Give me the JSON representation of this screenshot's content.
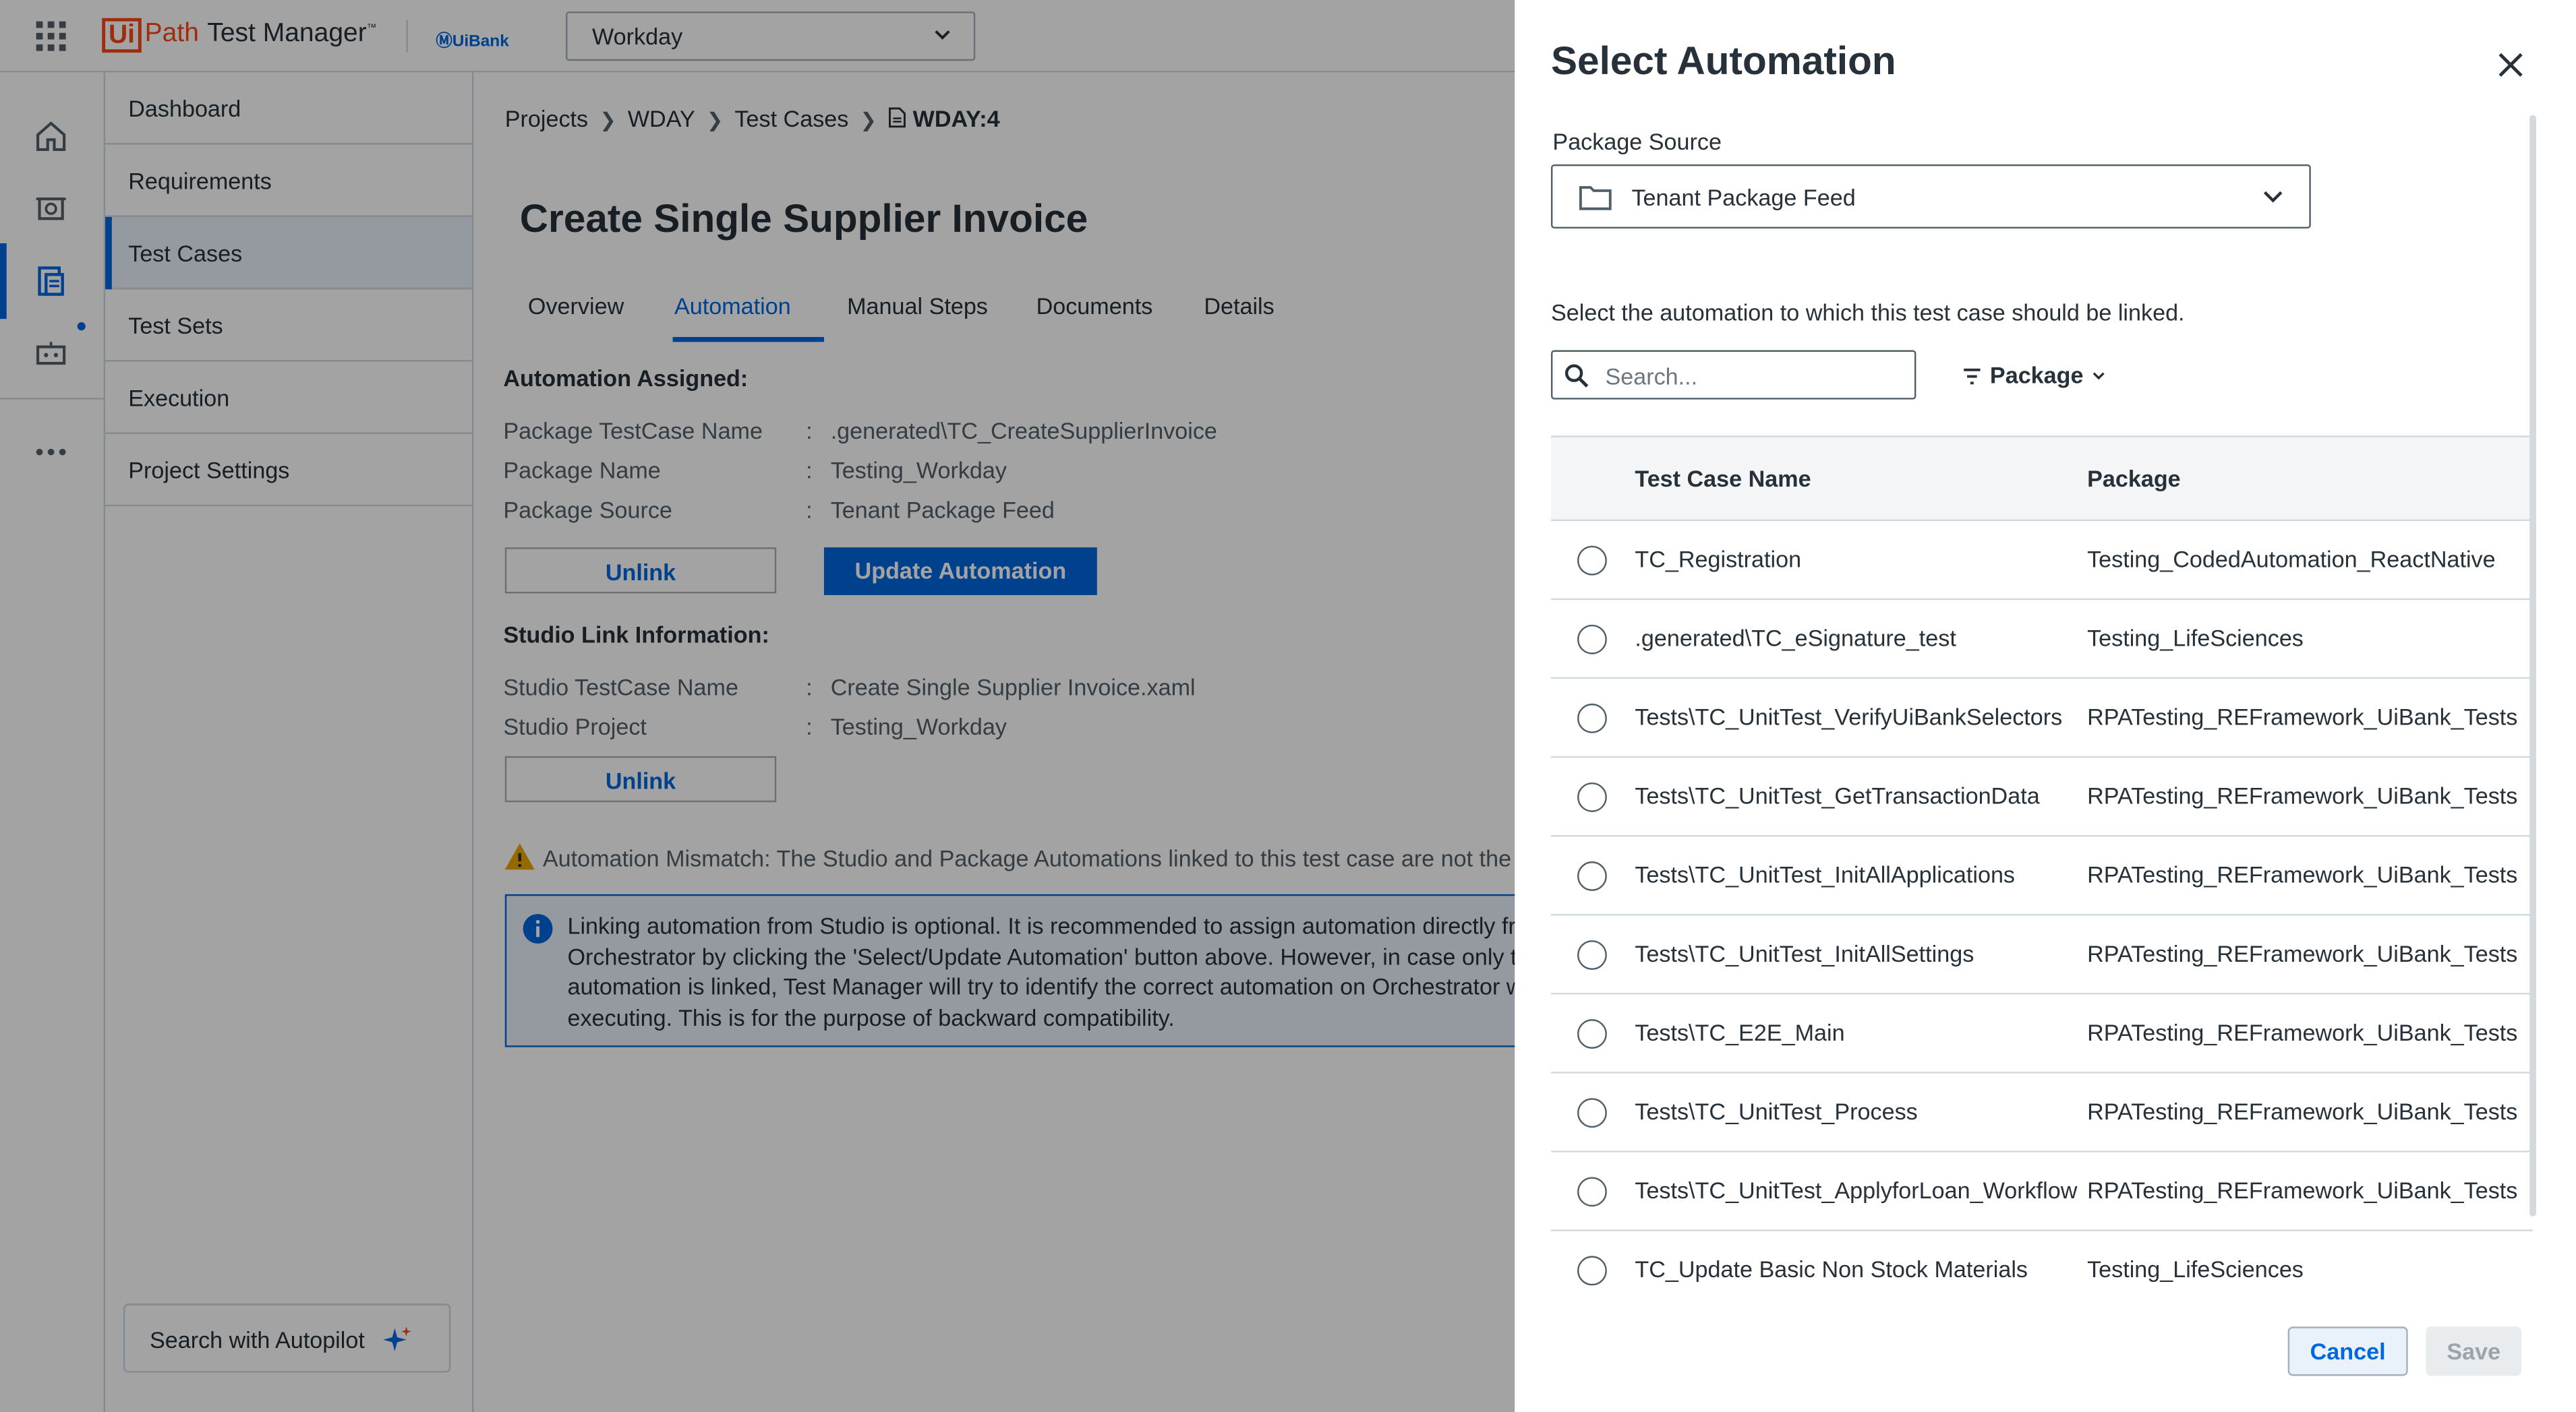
{
  "header": {
    "logo_box": "Ui",
    "logo_path": "Path",
    "product": "Test Manager",
    "tm_mark": "™",
    "tenant": "UiBank",
    "project": "Workday"
  },
  "nav": {
    "items": [
      {
        "label": "Dashboard"
      },
      {
        "label": "Requirements"
      },
      {
        "label": "Test Cases"
      },
      {
        "label": "Test Sets"
      },
      {
        "label": "Execution"
      },
      {
        "label": "Project Settings"
      }
    ],
    "autopilot": "Search with Autopilot"
  },
  "breadcrumb": [
    "Projects",
    "WDAY",
    "Test Cases",
    "WDAY:4"
  ],
  "page_title": "Create Single Supplier Invoice",
  "tabs": [
    "Overview",
    "Automation",
    "Manual Steps",
    "Documents",
    "Details"
  ],
  "automation": {
    "assigned_title": "Automation Assigned:",
    "assigned": [
      {
        "label": "Package TestCase Name",
        "value": ".generated\\TC_CreateSupplierInvoice"
      },
      {
        "label": "Package Name",
        "value": "Testing_Workday"
      },
      {
        "label": "Package Source",
        "value": "Tenant Package Feed"
      }
    ],
    "unlink": "Unlink",
    "update": "Update Automation",
    "studio_title": "Studio Link Information:",
    "studio": [
      {
        "label": "Studio TestCase Name",
        "value": "Create Single Supplier Invoice.xaml"
      },
      {
        "label": "Studio Project",
        "value": "Testing_Workday"
      }
    ],
    "colon": ":",
    "warning": "Automation Mismatch: The Studio and Package Automations linked to this test case are not the sa",
    "info_lines": [
      "Linking automation from Studio is optional. It is recommended to assign automation directly fr",
      "Orchestrator by clicking the 'Select/Update Automation' button above. However, in case only th",
      "automation is linked, Test Manager will try to identify the correct automation on Orchestrator w",
      "executing. This is for the purpose of backward compatibility."
    ]
  },
  "drawer": {
    "title": "Select Automation",
    "source_label": "Package Source",
    "source_value": "Tenant Package Feed",
    "description": "Select the automation to which this test case should be linked.",
    "search_placeholder": "Search...",
    "filter_label": "Package",
    "columns": [
      "Test Case Name",
      "Package"
    ],
    "rows": [
      {
        "name": "TC_Registration",
        "package": "Testing_CodedAutomation_ReactNative"
      },
      {
        "name": ".generated\\TC_eSignature_test",
        "package": "Testing_LifeSciences"
      },
      {
        "name": "Tests\\TC_UnitTest_VerifyUiBankSelectors",
        "package": "RPATesting_REFramework_UiBank_Tests"
      },
      {
        "name": "Tests\\TC_UnitTest_GetTransactionData",
        "package": "RPATesting_REFramework_UiBank_Tests"
      },
      {
        "name": "Tests\\TC_UnitTest_InitAllApplications",
        "package": "RPATesting_REFramework_UiBank_Tests"
      },
      {
        "name": "Tests\\TC_UnitTest_InitAllSettings",
        "package": "RPATesting_REFramework_UiBank_Tests"
      },
      {
        "name": "Tests\\TC_E2E_Main",
        "package": "RPATesting_REFramework_UiBank_Tests"
      },
      {
        "name": "Tests\\TC_UnitTest_Process",
        "package": "RPATesting_REFramework_UiBank_Tests"
      },
      {
        "name": "Tests\\TC_UnitTest_ApplyforLoan_Workflow",
        "package": "RPATesting_REFramework_UiBank_Tests"
      },
      {
        "name": "TC_Update Basic Non Stock Materials",
        "package": "Testing_LifeSciences"
      }
    ],
    "cancel": "Cancel",
    "save": "Save"
  },
  "colors": {
    "accent": "#0067df",
    "brand": "#fa4616",
    "warning": "#e8a400"
  }
}
